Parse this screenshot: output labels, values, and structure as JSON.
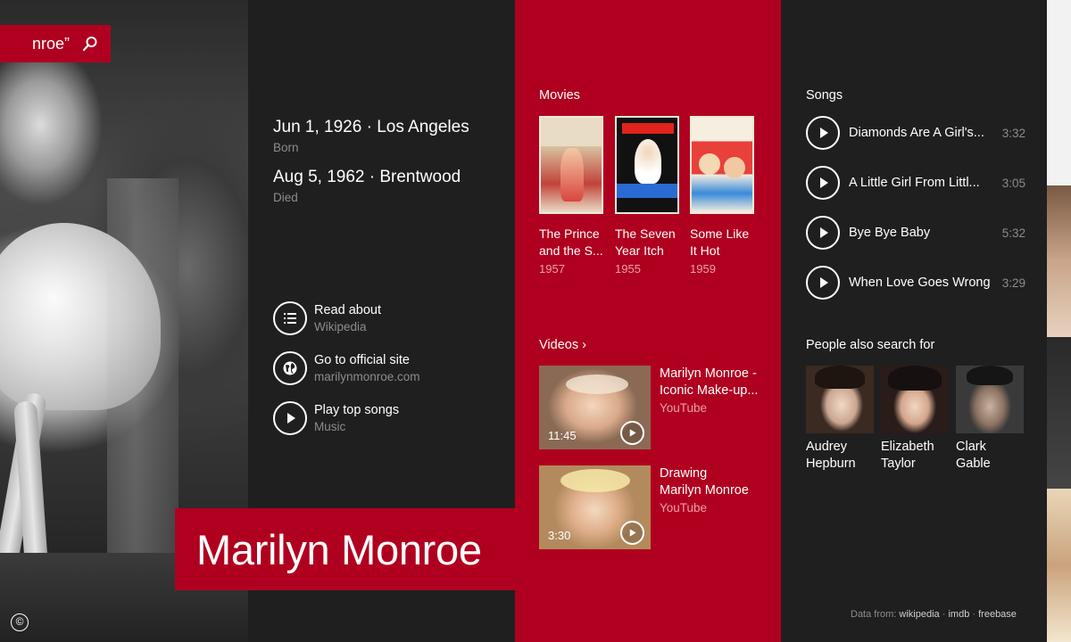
{
  "search": {
    "query": "nroe”"
  },
  "person": {
    "name": "Marilyn Monroe",
    "born_main": "Jun 1, 1926 · Los Angeles",
    "born_label": "Born",
    "died_main": "Aug 5, 1962 · Brentwood",
    "died_label": "Died"
  },
  "actions": [
    {
      "label": "Read about",
      "sub": "Wikipedia",
      "icon": "list-icon"
    },
    {
      "label": "Go to official site",
      "sub": "marilynmonroe.com",
      "icon": "globe-icon"
    },
    {
      "label": "Play top songs",
      "sub": "Music",
      "icon": "play-icon"
    }
  ],
  "movies": {
    "title": "Movies",
    "items": [
      {
        "title_l1": "The Prince",
        "title_l2": "and the S...",
        "year": "1957"
      },
      {
        "title_l1": "The Seven",
        "title_l2": "Year Itch",
        "year": "1955"
      },
      {
        "title_l1": "Some Like",
        "title_l2": "It Hot",
        "year": "1959"
      }
    ]
  },
  "videos": {
    "title": "Videos ›",
    "items": [
      {
        "title_l1": "Marilyn Monroe -",
        "title_l2": "Iconic Make-up...",
        "source": "YouTube",
        "duration": "11:45"
      },
      {
        "title_l1": "Drawing",
        "title_l2": "Marilyn Monroe",
        "source": "YouTube",
        "duration": "3:30"
      }
    ]
  },
  "songs": {
    "title": "Songs",
    "items": [
      {
        "title": "Diamonds Are A Girl's...",
        "duration": "3:32"
      },
      {
        "title": "A Little Girl From Littl...",
        "duration": "3:05"
      },
      {
        "title": "Bye Bye Baby",
        "duration": "5:32"
      },
      {
        "title": "When Love Goes Wrong",
        "duration": "3:29"
      }
    ]
  },
  "people": {
    "title": "People also search for",
    "items": [
      {
        "name_l1": "Audrey",
        "name_l2": "Hepburn"
      },
      {
        "name_l1": "Elizabeth",
        "name_l2": "Taylor"
      },
      {
        "name_l1": "Clark Gable",
        "name_l2": ""
      }
    ]
  },
  "footer": {
    "data_from": "Data from:",
    "sources": [
      "wikipedia",
      "imdb",
      "freebase"
    ],
    "sep": "·"
  },
  "colors": {
    "accent": "#b0001f",
    "panel": "#1f1f1f",
    "muted": "#8c8c8c"
  },
  "hero": {
    "copyright_symbol": "©"
  }
}
